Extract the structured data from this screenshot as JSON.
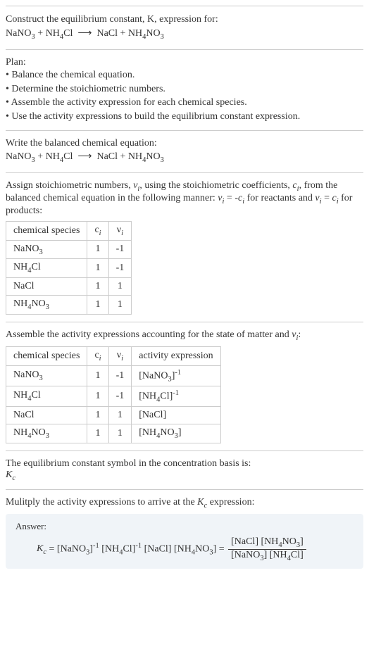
{
  "problem": {
    "intro": "Construct the equilibrium constant, K, expression for:",
    "equation": "NaNO<span class='sub'>3</span> + NH<span class='sub'>4</span>Cl &nbsp;⟶&nbsp; NaCl + NH<span class='sub'>4</span>NO<span class='sub'>3</span>"
  },
  "plan": {
    "heading": "Plan:",
    "items": [
      "• Balance the chemical equation.",
      "• Determine the stoichiometric numbers.",
      "• Assemble the activity expression for each chemical species.",
      "• Use the activity expressions to build the equilibrium constant expression."
    ]
  },
  "balanced": {
    "heading": "Write the balanced chemical equation:",
    "equation": "NaNO<span class='sub'>3</span> + NH<span class='sub'>4</span>Cl &nbsp;⟶&nbsp; NaCl + NH<span class='sub'>4</span>NO<span class='sub'>3</span>"
  },
  "stoich": {
    "heading": "Assign stoichiometric numbers, <span class='italic'>ν<span class='sub'>i</span></span>, using the stoichiometric coefficients, <span class='italic'>c<span class='sub'>i</span></span>, from the balanced chemical equation in the following manner: <span class='italic'>ν<span class='sub'>i</span></span> = -<span class='italic'>c<span class='sub'>i</span></span> for reactants and <span class='italic'>ν<span class='sub'>i</span></span> = <span class='italic'>c<span class='sub'>i</span></span> for products:",
    "headers": [
      "chemical species",
      "c<span class='sub italic'>i</span>",
      "ν<span class='sub italic'>i</span>"
    ],
    "rows": [
      {
        "species": "NaNO<span class='sub'>3</span>",
        "c": "1",
        "v": "-1"
      },
      {
        "species": "NH<span class='sub'>4</span>Cl",
        "c": "1",
        "v": "-1"
      },
      {
        "species": "NaCl",
        "c": "1",
        "v": "1"
      },
      {
        "species": "NH<span class='sub'>4</span>NO<span class='sub'>3</span>",
        "c": "1",
        "v": "1"
      }
    ]
  },
  "activity": {
    "heading": "Assemble the activity expressions accounting for the state of matter and <span class='italic'>ν<span class='sub'>i</span></span>:",
    "headers": [
      "chemical species",
      "c<span class='sub italic'>i</span>",
      "ν<span class='sub italic'>i</span>",
      "activity expression"
    ],
    "rows": [
      {
        "species": "NaNO<span class='sub'>3</span>",
        "c": "1",
        "v": "-1",
        "expr": "[NaNO<span class='sub'>3</span>]<span class='sup'>-1</span>"
      },
      {
        "species": "NH<span class='sub'>4</span>Cl",
        "c": "1",
        "v": "-1",
        "expr": "[NH<span class='sub'>4</span>Cl]<span class='sup'>-1</span>"
      },
      {
        "species": "NaCl",
        "c": "1",
        "v": "1",
        "expr": "[NaCl]"
      },
      {
        "species": "NH<span class='sub'>4</span>NO<span class='sub'>3</span>",
        "c": "1",
        "v": "1",
        "expr": "[NH<span class='sub'>4</span>NO<span class='sub'>3</span>]"
      }
    ]
  },
  "symbol": {
    "heading": "The equilibrium constant symbol in the concentration basis is:",
    "value": "<span class='italic'>K<span class='sub'>c</span></span>"
  },
  "final": {
    "heading": "Mulitply the activity expressions to arrive at the <span class='italic'>K<span class='sub'>c</span></span> expression:",
    "answer_label": "Answer:",
    "answer": "<span class='italic'>K<span class='sub'>c</span></span> = [NaNO<span class='sub'>3</span>]<span class='sup'>-1</span> [NH<span class='sub'>4</span>Cl]<span class='sup'>-1</span> [NaCl] [NH<span class='sub'>4</span>NO<span class='sub'>3</span>] = <span class='frac'><span class='num'>[NaCl] [NH<span class='sub'>4</span>NO<span class='sub'>3</span>]</span><span class='den'>[NaNO<span class='sub'>3</span>] [NH<span class='sub'>4</span>Cl]</span></span>"
  }
}
